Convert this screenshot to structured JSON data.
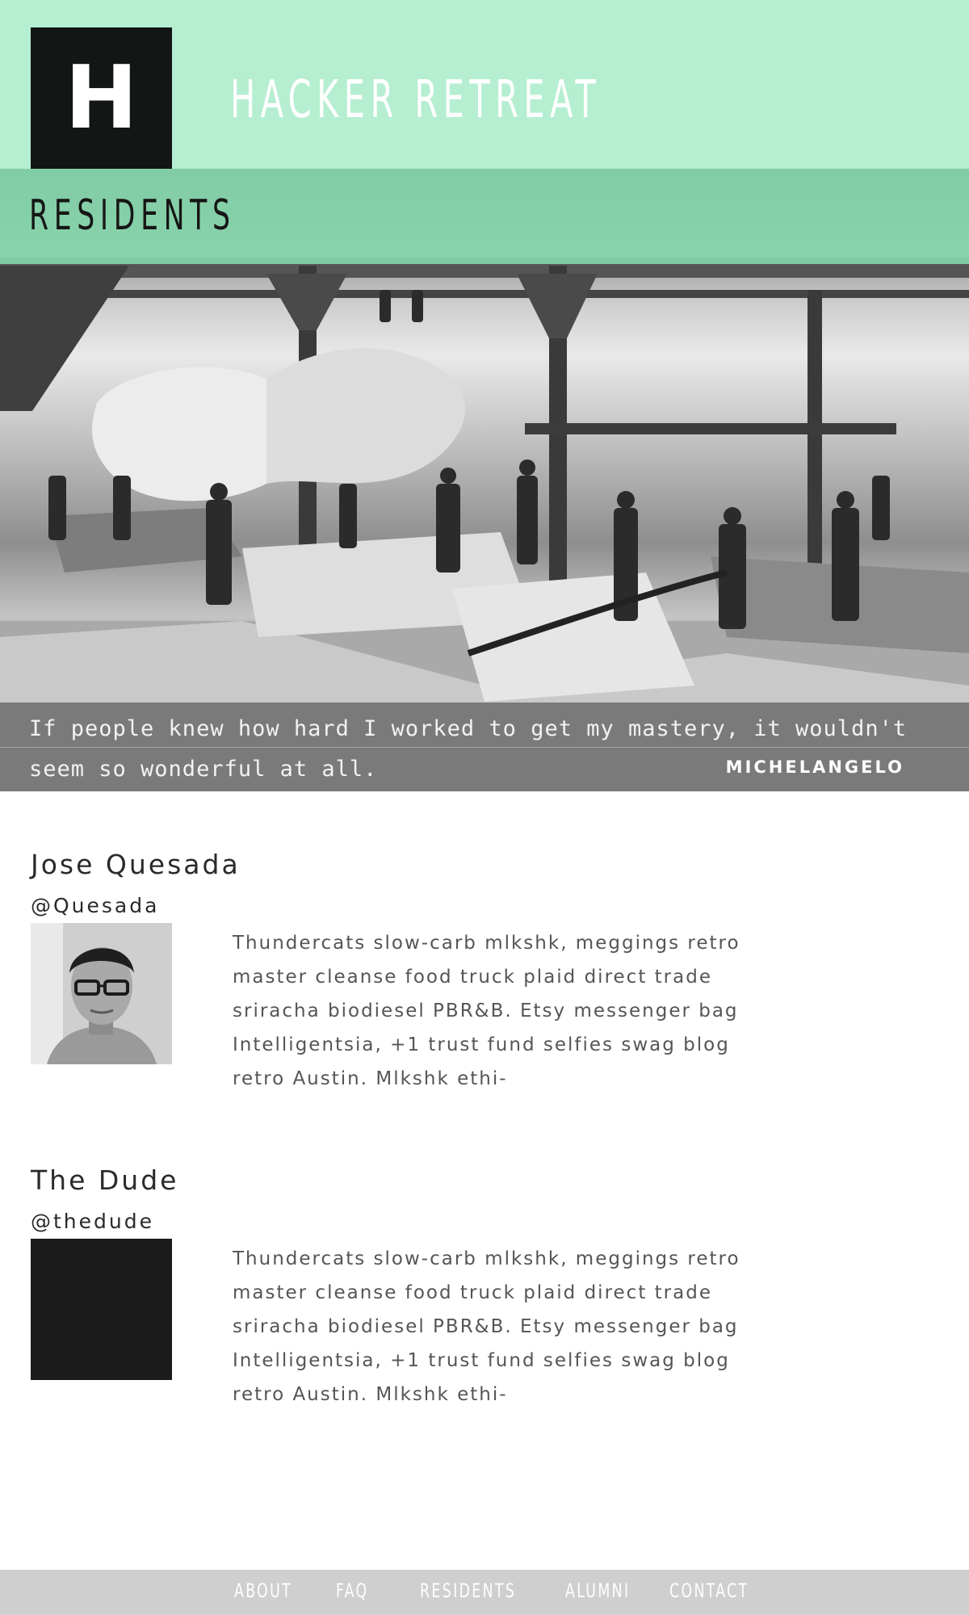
{
  "header": {
    "logo_letter": "H",
    "site_title": "HACKER RETREAT"
  },
  "hero": {
    "page_title": "RESIDENTS",
    "quote": "If people knew how hard I worked to get my mastery, it wouldn't seem so wonderful at all.",
    "quote_author": "MICHELANGELO"
  },
  "residents": [
    {
      "name": "Jose Quesada",
      "handle": "@Quesada",
      "bio": "Thundercats slow-carb mlkshk, meggings retro master cleanse food truck plaid direct trade sriracha biodiesel PBR&B. Etsy messenger bag Intelligentsia, +1 trust fund selfies swag blog retro Austin. Mlkshk ethi-",
      "avatar": "photo"
    },
    {
      "name": "The Dude",
      "handle": "@thedude",
      "bio": "Thundercats slow-carb mlkshk, meggings retro master cleanse food truck plaid direct trade sriracha biodiesel PBR&B. Etsy messenger bag Intelligentsia, +1 trust fund selfies swag blog retro Austin. Mlkshk ethi-",
      "avatar": "placeholder-black"
    }
  ],
  "footer": {
    "nav": [
      "ABOUT",
      "FAQ",
      "RESIDENTS",
      "ALUMNI",
      "CONTACT"
    ]
  },
  "colors": {
    "header_mint": "#b6eed1",
    "band_green": "#86dcae",
    "logo_black": "#121614",
    "quote_band": "#7a7a7a",
    "footer_gray": "#cfcfcf"
  }
}
